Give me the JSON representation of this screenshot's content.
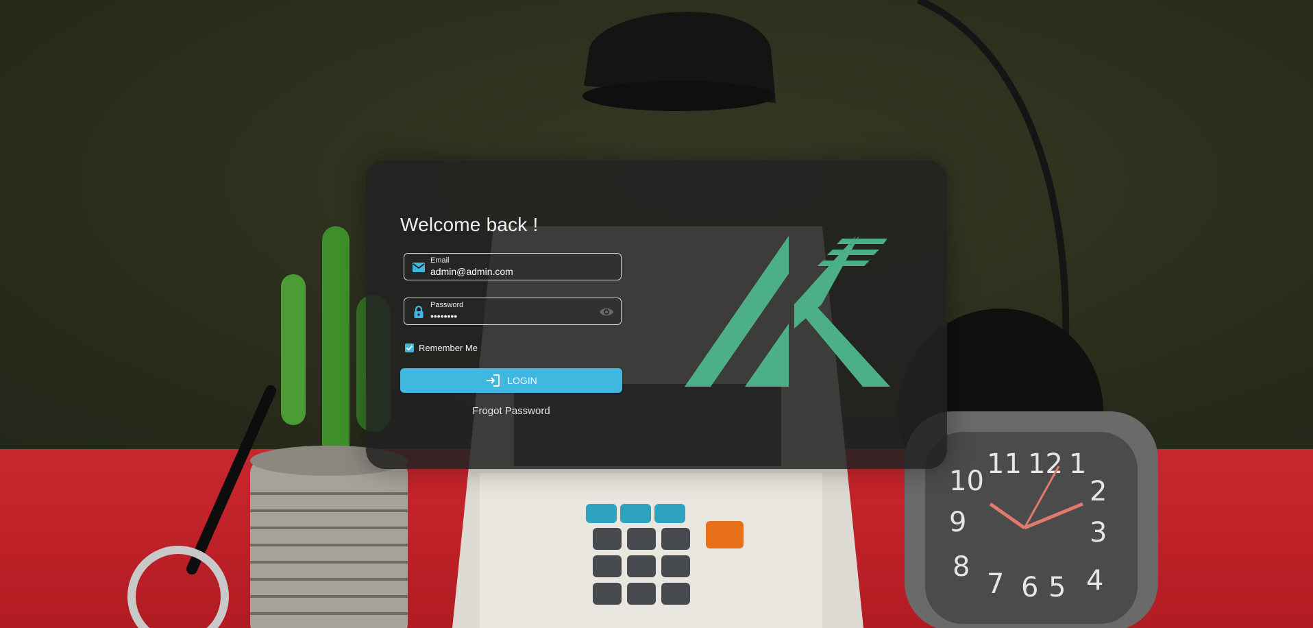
{
  "login": {
    "welcome_title": "Welcome back !",
    "email": {
      "label": "Email",
      "value": "admin@admin.com",
      "icon": "email-icon"
    },
    "password": {
      "label": "Password",
      "value": "adminpwd",
      "icon": "lock-icon",
      "toggle_icon": "eye-icon"
    },
    "remember_me": {
      "label": "Remember Me",
      "checked": true
    },
    "login_button": {
      "label": "LOGIN",
      "icon": "login-icon"
    },
    "forgot_password_link": "Frogot Password"
  },
  "theme": {
    "accent": "#3fb7df",
    "logo_color": "#4caf88",
    "card_background": "#222222"
  }
}
